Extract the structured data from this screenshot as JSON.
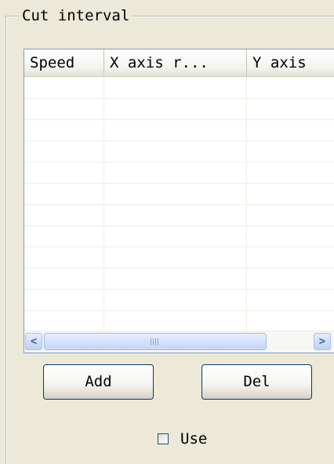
{
  "group": {
    "title": "Cut interval"
  },
  "list": {
    "columns": [
      "Speed",
      "X axis r...",
      "Y axis"
    ],
    "row_count": 12
  },
  "buttons": {
    "add_label": "Add",
    "del_label": "Del"
  },
  "checkbox": {
    "label": "Use",
    "checked": false
  },
  "scrollbar": {
    "left_icon": "scroll-left-arrow-icon",
    "right_icon": "scroll-right-arrow-icon"
  }
}
